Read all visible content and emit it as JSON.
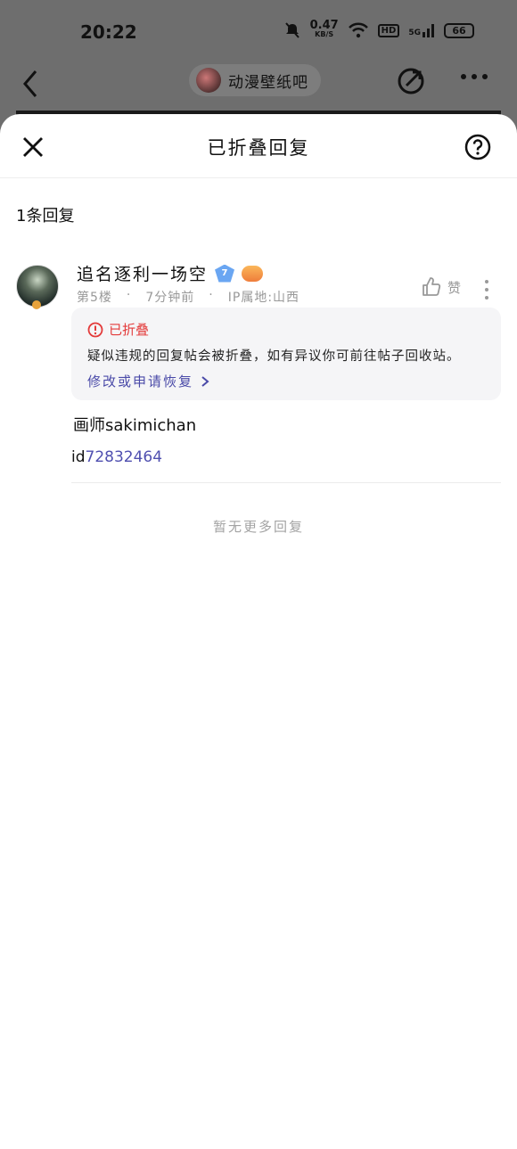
{
  "status_bar": {
    "time": "20:22",
    "speed_value": "0.47",
    "speed_unit": "KB/S",
    "hd": "HD",
    "network": "5G",
    "battery": "66"
  },
  "background": {
    "forum_name": "动漫壁纸吧"
  },
  "sheet": {
    "title": "已折叠回复",
    "reply_count": "1条回复",
    "no_more": "暂无更多回复"
  },
  "post": {
    "username": "追名逐利一场空",
    "level": "7",
    "floor": "第5楼",
    "time_ago": "7分钟前",
    "ip_location": "IP属地:山西",
    "like_label": "赞",
    "folded_title": "已折叠",
    "folded_desc": "疑似违规的回复帖会被折叠，如有异议你可前往帖子回收站。",
    "appeal_link": "修改或申请恢复",
    "content_line1": "画师sakimichan",
    "content_id_prefix": "id",
    "content_id_number": "72832464"
  },
  "colors": {
    "fold_red": "#e33a3a",
    "link_purple": "#4a4aa8",
    "muted_gray": "#999999"
  }
}
